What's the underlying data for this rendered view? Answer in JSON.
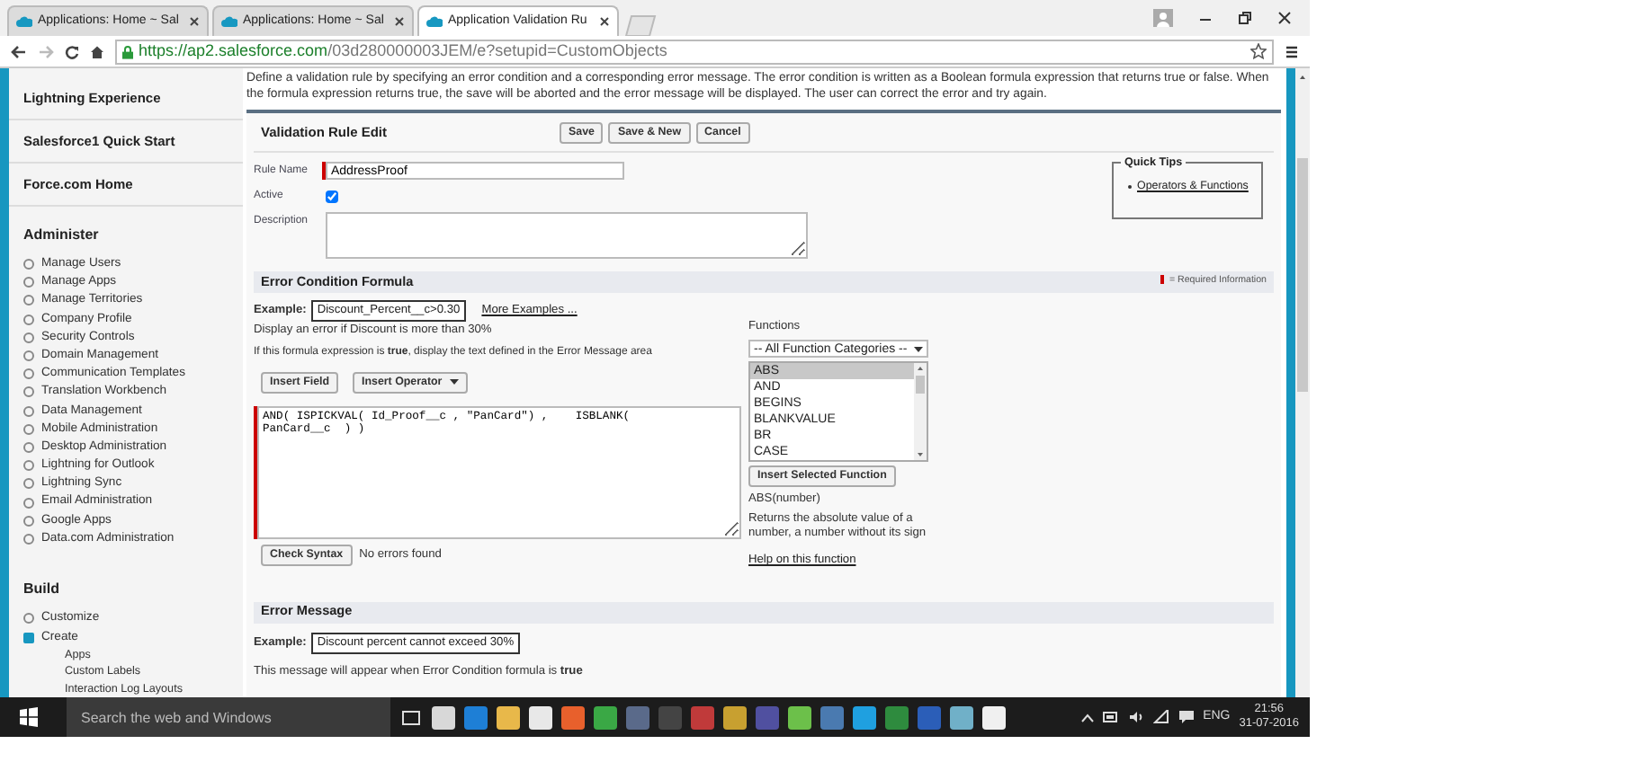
{
  "browser": {
    "tabs": [
      {
        "title": "Applications: Home ~ Sal",
        "selected": false
      },
      {
        "title": "Applications: Home ~ Sal",
        "selected": false
      },
      {
        "title": "Application Validation Ru",
        "selected": true
      }
    ],
    "url": {
      "host": "https://ap2.salesforce.com",
      "path": "/03d280000003JEM/e?setupid=CustomObjects"
    }
  },
  "sidebar": {
    "top_links": [
      "Lightning Experience",
      "Salesforce1 Quick Start",
      "Force.com Home"
    ],
    "sections": [
      {
        "title": "Administer",
        "items": [
          {
            "label": "Manage Users",
            "expanded": false
          },
          {
            "label": "Manage Apps",
            "expanded": false
          },
          {
            "label": "Manage Territories",
            "expanded": false
          },
          {
            "label": "Company Profile",
            "expanded": false
          },
          {
            "label": "Security Controls",
            "expanded": false
          },
          {
            "label": "Domain Management",
            "expanded": false
          },
          {
            "label": "Communication Templates",
            "expanded": false
          },
          {
            "label": "Translation Workbench",
            "expanded": false
          },
          {
            "label": "Data Management",
            "expanded": false
          },
          {
            "label": "Mobile Administration",
            "expanded": false
          },
          {
            "label": "Desktop Administration",
            "expanded": false
          },
          {
            "label": "Lightning for Outlook",
            "expanded": false
          },
          {
            "label": "Lightning Sync",
            "expanded": false
          },
          {
            "label": "Email Administration",
            "expanded": false
          },
          {
            "label": "Google Apps",
            "expanded": false
          },
          {
            "label": "Data.com Administration",
            "expanded": false
          }
        ]
      },
      {
        "title": "Build",
        "items": [
          {
            "label": "Customize",
            "expanded": false
          },
          {
            "label": "Create",
            "expanded": true,
            "children": [
              "Apps",
              "Custom Labels",
              "Interaction Log Layouts"
            ]
          }
        ]
      }
    ]
  },
  "intro": "Define a validation rule by specifying an error condition and a corresponding error message. The error condition is written as a Boolean formula expression that returns true or false. When the formula expression returns true, the save will be aborted and the error message will be displayed. The user can correct the error and try again.",
  "form": {
    "title": "Validation Rule Edit",
    "buttons": [
      "Save",
      "Save & New",
      "Cancel"
    ],
    "rule_name": {
      "label": "Rule Name",
      "value": "AddressProof",
      "required": true
    },
    "active": {
      "label": "Active",
      "checked": true
    },
    "description": {
      "label": "Description"
    },
    "quick_tips": {
      "title": "Quick Tips",
      "links": [
        "Operators & Functions"
      ]
    }
  },
  "formula_section": {
    "title": "Error Condition Formula",
    "required_legend": "= Required Information",
    "example_label": "Example:",
    "example_value": "Discount_Percent__c>0.30",
    "more_examples": "More Examples ...",
    "hint": "Display an error if Discount is more than 30%",
    "note": "If this formula expression is **true**, display the text defined in the Error Message area",
    "insert_field": "Insert Field",
    "insert_operator": "Insert Operator",
    "formula": {
      "value": "AND( ISPICKVAL( Id_Proof__c , \"PanCard\") ,    ISBLANK(\nPanCard__c  ) )",
      "required": true
    },
    "check_syntax": "Check Syntax",
    "syntax_status": "No errors found",
    "functions": {
      "label": "Functions",
      "category": "-- All Function Categories --",
      "list": [
        {
          "name": "ABS",
          "selected": true
        },
        {
          "name": "AND",
          "selected": false
        },
        {
          "name": "BEGINS",
          "selected": false
        },
        {
          "name": "BLANKVALUE",
          "selected": false
        },
        {
          "name": "BR",
          "selected": false
        },
        {
          "name": "CASE",
          "selected": false
        }
      ],
      "insert_button": "Insert Selected Function",
      "signature": "ABS(number)",
      "description": "Returns the absolute value of a number, a number without its sign",
      "help_link": "Help on this function"
    }
  },
  "error_section": {
    "title": "Error Message",
    "example_label": "Example:",
    "example_value": "Discount percent cannot exceed 30%",
    "note": "This message will appear when Error Condition formula is **true**"
  },
  "taskbar": {
    "search_placeholder": "Search the web and Windows",
    "apps": [
      {
        "color": "#d8d8d8"
      },
      {
        "color": "#1e7fd6"
      },
      {
        "color": "#e8b84a"
      },
      {
        "color": "#e8e8e8"
      },
      {
        "color": "#e8602c"
      },
      {
        "color": "#3aa845"
      },
      {
        "color": "#5a6a8a"
      },
      {
        "color": "#444444"
      },
      {
        "color": "#c03a3a"
      },
      {
        "color": "#c8a030"
      },
      {
        "color": "#5050a0"
      },
      {
        "color": "#6cc04a"
      },
      {
        "color": "#4a7ab0"
      },
      {
        "color": "#1fa0e0"
      },
      {
        "color": "#2e8b3e"
      },
      {
        "color": "#2b5eb8"
      },
      {
        "color": "#70b0c8"
      },
      {
        "color": "#f0f0f0"
      }
    ],
    "language": "ENG",
    "time": "21:56",
    "date": "31-07-2016"
  }
}
